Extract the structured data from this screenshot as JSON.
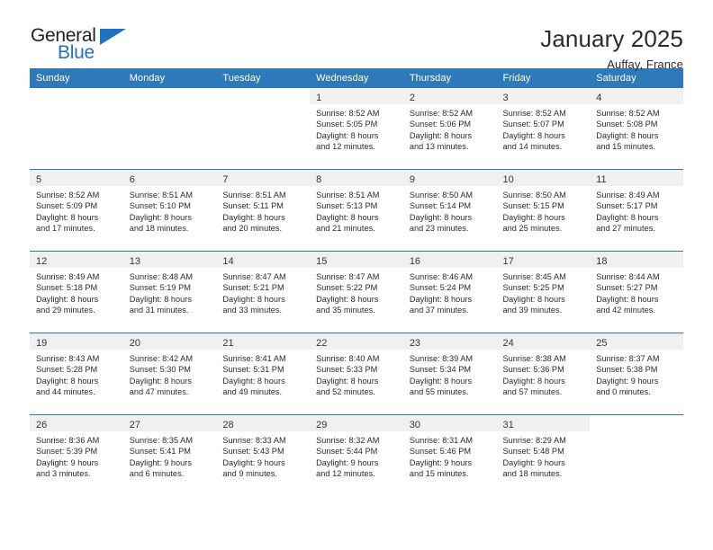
{
  "brand": {
    "name_top": "General",
    "name_bottom": "Blue",
    "accent_color": "#1f72bd"
  },
  "header": {
    "title": "January 2025",
    "subtitle": "Auffay, France"
  },
  "theme": {
    "header_bg": "#2e79b9",
    "header_text": "#ffffff",
    "daynum_band_bg": "#f0f0f0",
    "row_divider": "#2e79b9",
    "body_text": "#2b2b2b"
  },
  "weekday_headers": [
    "Sunday",
    "Monday",
    "Tuesday",
    "Wednesday",
    "Thursday",
    "Friday",
    "Saturday"
  ],
  "weeks": [
    [
      {
        "day": "",
        "lines": []
      },
      {
        "day": "",
        "lines": []
      },
      {
        "day": "",
        "lines": []
      },
      {
        "day": "1",
        "lines": [
          "Sunrise: 8:52 AM",
          "Sunset: 5:05 PM",
          "Daylight: 8 hours",
          "and 12 minutes."
        ]
      },
      {
        "day": "2",
        "lines": [
          "Sunrise: 8:52 AM",
          "Sunset: 5:06 PM",
          "Daylight: 8 hours",
          "and 13 minutes."
        ]
      },
      {
        "day": "3",
        "lines": [
          "Sunrise: 8:52 AM",
          "Sunset: 5:07 PM",
          "Daylight: 8 hours",
          "and 14 minutes."
        ]
      },
      {
        "day": "4",
        "lines": [
          "Sunrise: 8:52 AM",
          "Sunset: 5:08 PM",
          "Daylight: 8 hours",
          "and 15 minutes."
        ]
      }
    ],
    [
      {
        "day": "5",
        "lines": [
          "Sunrise: 8:52 AM",
          "Sunset: 5:09 PM",
          "Daylight: 8 hours",
          "and 17 minutes."
        ]
      },
      {
        "day": "6",
        "lines": [
          "Sunrise: 8:51 AM",
          "Sunset: 5:10 PM",
          "Daylight: 8 hours",
          "and 18 minutes."
        ]
      },
      {
        "day": "7",
        "lines": [
          "Sunrise: 8:51 AM",
          "Sunset: 5:11 PM",
          "Daylight: 8 hours",
          "and 20 minutes."
        ]
      },
      {
        "day": "8",
        "lines": [
          "Sunrise: 8:51 AM",
          "Sunset: 5:13 PM",
          "Daylight: 8 hours",
          "and 21 minutes."
        ]
      },
      {
        "day": "9",
        "lines": [
          "Sunrise: 8:50 AM",
          "Sunset: 5:14 PM",
          "Daylight: 8 hours",
          "and 23 minutes."
        ]
      },
      {
        "day": "10",
        "lines": [
          "Sunrise: 8:50 AM",
          "Sunset: 5:15 PM",
          "Daylight: 8 hours",
          "and 25 minutes."
        ]
      },
      {
        "day": "11",
        "lines": [
          "Sunrise: 8:49 AM",
          "Sunset: 5:17 PM",
          "Daylight: 8 hours",
          "and 27 minutes."
        ]
      }
    ],
    [
      {
        "day": "12",
        "lines": [
          "Sunrise: 8:49 AM",
          "Sunset: 5:18 PM",
          "Daylight: 8 hours",
          "and 29 minutes."
        ]
      },
      {
        "day": "13",
        "lines": [
          "Sunrise: 8:48 AM",
          "Sunset: 5:19 PM",
          "Daylight: 8 hours",
          "and 31 minutes."
        ]
      },
      {
        "day": "14",
        "lines": [
          "Sunrise: 8:47 AM",
          "Sunset: 5:21 PM",
          "Daylight: 8 hours",
          "and 33 minutes."
        ]
      },
      {
        "day": "15",
        "lines": [
          "Sunrise: 8:47 AM",
          "Sunset: 5:22 PM",
          "Daylight: 8 hours",
          "and 35 minutes."
        ]
      },
      {
        "day": "16",
        "lines": [
          "Sunrise: 8:46 AM",
          "Sunset: 5:24 PM",
          "Daylight: 8 hours",
          "and 37 minutes."
        ]
      },
      {
        "day": "17",
        "lines": [
          "Sunrise: 8:45 AM",
          "Sunset: 5:25 PM",
          "Daylight: 8 hours",
          "and 39 minutes."
        ]
      },
      {
        "day": "18",
        "lines": [
          "Sunrise: 8:44 AM",
          "Sunset: 5:27 PM",
          "Daylight: 8 hours",
          "and 42 minutes."
        ]
      }
    ],
    [
      {
        "day": "19",
        "lines": [
          "Sunrise: 8:43 AM",
          "Sunset: 5:28 PM",
          "Daylight: 8 hours",
          "and 44 minutes."
        ]
      },
      {
        "day": "20",
        "lines": [
          "Sunrise: 8:42 AM",
          "Sunset: 5:30 PM",
          "Daylight: 8 hours",
          "and 47 minutes."
        ]
      },
      {
        "day": "21",
        "lines": [
          "Sunrise: 8:41 AM",
          "Sunset: 5:31 PM",
          "Daylight: 8 hours",
          "and 49 minutes."
        ]
      },
      {
        "day": "22",
        "lines": [
          "Sunrise: 8:40 AM",
          "Sunset: 5:33 PM",
          "Daylight: 8 hours",
          "and 52 minutes."
        ]
      },
      {
        "day": "23",
        "lines": [
          "Sunrise: 8:39 AM",
          "Sunset: 5:34 PM",
          "Daylight: 8 hours",
          "and 55 minutes."
        ]
      },
      {
        "day": "24",
        "lines": [
          "Sunrise: 8:38 AM",
          "Sunset: 5:36 PM",
          "Daylight: 8 hours",
          "and 57 minutes."
        ]
      },
      {
        "day": "25",
        "lines": [
          "Sunrise: 8:37 AM",
          "Sunset: 5:38 PM",
          "Daylight: 9 hours",
          "and 0 minutes."
        ]
      }
    ],
    [
      {
        "day": "26",
        "lines": [
          "Sunrise: 8:36 AM",
          "Sunset: 5:39 PM",
          "Daylight: 9 hours",
          "and 3 minutes."
        ]
      },
      {
        "day": "27",
        "lines": [
          "Sunrise: 8:35 AM",
          "Sunset: 5:41 PM",
          "Daylight: 9 hours",
          "and 6 minutes."
        ]
      },
      {
        "day": "28",
        "lines": [
          "Sunrise: 8:33 AM",
          "Sunset: 5:43 PM",
          "Daylight: 9 hours",
          "and 9 minutes."
        ]
      },
      {
        "day": "29",
        "lines": [
          "Sunrise: 8:32 AM",
          "Sunset: 5:44 PM",
          "Daylight: 9 hours",
          "and 12 minutes."
        ]
      },
      {
        "day": "30",
        "lines": [
          "Sunrise: 8:31 AM",
          "Sunset: 5:46 PM",
          "Daylight: 9 hours",
          "and 15 minutes."
        ]
      },
      {
        "day": "31",
        "lines": [
          "Sunrise: 8:29 AM",
          "Sunset: 5:48 PM",
          "Daylight: 9 hours",
          "and 18 minutes."
        ]
      },
      {
        "day": "",
        "lines": []
      }
    ]
  ]
}
